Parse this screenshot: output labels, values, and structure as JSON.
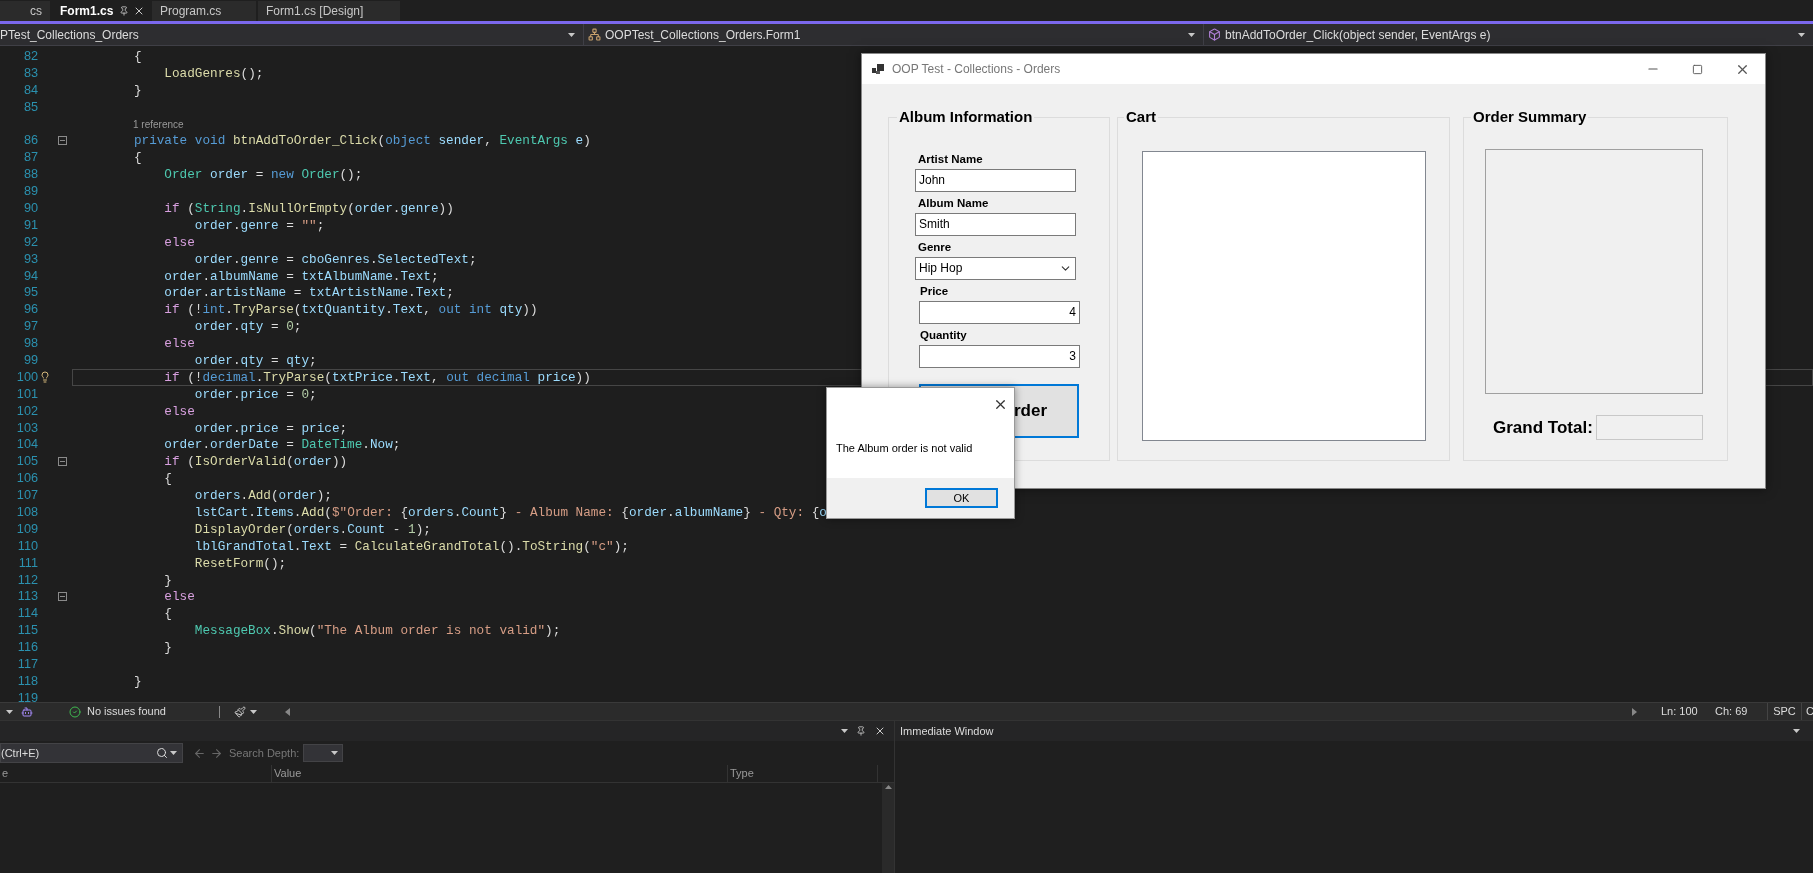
{
  "tabs": [
    {
      "label": "cs",
      "selected": false
    },
    {
      "label": "Form1.cs",
      "selected": true
    },
    {
      "label": "Program.cs",
      "selected": false
    },
    {
      "label": "Form1.cs [Design]",
      "selected": false
    }
  ],
  "nav_bar": {
    "project": "PTest_Collections_Orders",
    "type": "OOPTest_Collections_Orders.Form1",
    "member": "btnAddToOrder_Click(object sender, EventArgs e)"
  },
  "editor": {
    "lines": [
      {
        "kind": "code",
        "number": "82",
        "current": false,
        "fold": false,
        "tokens": [
          {
            "kind": "p",
            "text": "        {"
          }
        ]
      },
      {
        "kind": "code",
        "number": "83",
        "current": false,
        "fold": false,
        "tokens": [
          {
            "kind": "fn",
            "text": "            LoadGenres"
          },
          {
            "kind": "p",
            "text": "();"
          }
        ]
      },
      {
        "kind": "code",
        "number": "84",
        "current": false,
        "fold": false,
        "tokens": [
          {
            "kind": "p",
            "text": "        }"
          }
        ]
      },
      {
        "kind": "code",
        "number": "85",
        "current": false,
        "fold": false
      },
      {
        "kind": "codelens",
        "text": "1 reference",
        "current": false,
        "fold": false
      },
      {
        "kind": "code",
        "number": "86",
        "current": false,
        "fold": true,
        "tokens": [
          {
            "kind": "kw",
            "text": "        private"
          },
          {
            "kind": "kw",
            "text": " void"
          },
          {
            "kind": "fn",
            "text": " btnAddToOrder_Click"
          },
          {
            "kind": "p",
            "text": "("
          },
          {
            "kind": "kw",
            "text": "object"
          },
          {
            "kind": "var",
            "text": " sender"
          },
          {
            "kind": "p",
            "text": ", "
          },
          {
            "kind": "type",
            "text": "EventArgs"
          },
          {
            "kind": "var",
            "text": " e"
          },
          {
            "kind": "p",
            "text": ")"
          }
        ]
      },
      {
        "kind": "code",
        "number": "87",
        "current": false,
        "fold": false,
        "tokens": [
          {
            "kind": "p",
            "text": "        {"
          }
        ]
      },
      {
        "kind": "code",
        "number": "88",
        "current": false,
        "fold": false,
        "tokens": [
          {
            "kind": "type",
            "text": "            Order"
          },
          {
            "kind": "var",
            "text": " order"
          },
          {
            "kind": "p",
            "text": " = "
          },
          {
            "kind": "kw",
            "text": "new"
          },
          {
            "kind": "type",
            "text": " Order"
          },
          {
            "kind": "p",
            "text": "();"
          }
        ]
      },
      {
        "kind": "code",
        "number": "89",
        "current": false,
        "fold": false
      },
      {
        "kind": "code",
        "number": "90",
        "current": false,
        "fold": false,
        "tokens": [
          {
            "kind": "ctl",
            "text": "            if"
          },
          {
            "kind": "p",
            "text": " ("
          },
          {
            "kind": "type",
            "text": "String"
          },
          {
            "kind": "p",
            "text": "."
          },
          {
            "kind": "fn",
            "text": "IsNullOrEmpty"
          },
          {
            "kind": "p",
            "text": "("
          },
          {
            "kind": "var",
            "text": "order"
          },
          {
            "kind": "p",
            "text": "."
          },
          {
            "kind": "var",
            "text": "genre"
          },
          {
            "kind": "p",
            "text": "))"
          }
        ]
      },
      {
        "kind": "code",
        "number": "91",
        "current": false,
        "fold": false,
        "tokens": [
          {
            "kind": "var",
            "text": "                order"
          },
          {
            "kind": "p",
            "text": "."
          },
          {
            "kind": "var",
            "text": "genre"
          },
          {
            "kind": "p",
            "text": " = "
          },
          {
            "kind": "str",
            "text": "\"\""
          },
          {
            "kind": "p",
            "text": ";"
          }
        ]
      },
      {
        "kind": "code",
        "number": "92",
        "current": false,
        "fold": false,
        "tokens": [
          {
            "kind": "ctl",
            "text": "            else"
          }
        ]
      },
      {
        "kind": "code",
        "number": "93",
        "current": false,
        "fold": false,
        "tokens": [
          {
            "kind": "var",
            "text": "                order"
          },
          {
            "kind": "p",
            "text": "."
          },
          {
            "kind": "var",
            "text": "genre"
          },
          {
            "kind": "p",
            "text": " = "
          },
          {
            "kind": "var",
            "text": "cboGenres"
          },
          {
            "kind": "p",
            "text": "."
          },
          {
            "kind": "var",
            "text": "SelectedText"
          },
          {
            "kind": "p",
            "text": ";"
          }
        ]
      },
      {
        "kind": "code",
        "number": "94",
        "current": false,
        "fold": false,
        "tokens": [
          {
            "kind": "var",
            "text": "            order"
          },
          {
            "kind": "p",
            "text": "."
          },
          {
            "kind": "var",
            "text": "albumName"
          },
          {
            "kind": "p",
            "text": " = "
          },
          {
            "kind": "var",
            "text": "txtAlbumName"
          },
          {
            "kind": "p",
            "text": "."
          },
          {
            "kind": "var",
            "text": "Text"
          },
          {
            "kind": "p",
            "text": ";"
          }
        ]
      },
      {
        "kind": "code",
        "number": "95",
        "current": false,
        "fold": false,
        "tokens": [
          {
            "kind": "var",
            "text": "            order"
          },
          {
            "kind": "p",
            "text": "."
          },
          {
            "kind": "var",
            "text": "artistName"
          },
          {
            "kind": "p",
            "text": " = "
          },
          {
            "kind": "var",
            "text": "txtArtistName"
          },
          {
            "kind": "p",
            "text": "."
          },
          {
            "kind": "var",
            "text": "Text"
          },
          {
            "kind": "p",
            "text": ";"
          }
        ]
      },
      {
        "kind": "code",
        "number": "96",
        "current": false,
        "fold": false,
        "tokens": [
          {
            "kind": "ctl",
            "text": "            if"
          },
          {
            "kind": "p",
            "text": " (!"
          },
          {
            "kind": "kw",
            "text": "int"
          },
          {
            "kind": "p",
            "text": "."
          },
          {
            "kind": "fn",
            "text": "TryParse"
          },
          {
            "kind": "p",
            "text": "("
          },
          {
            "kind": "var",
            "text": "txtQuantity"
          },
          {
            "kind": "p",
            "text": "."
          },
          {
            "kind": "var",
            "text": "Text"
          },
          {
            "kind": "p",
            "text": ", "
          },
          {
            "kind": "kw",
            "text": "out"
          },
          {
            "kind": "kw",
            "text": " int"
          },
          {
            "kind": "var",
            "text": " qty"
          },
          {
            "kind": "p",
            "text": "))"
          }
        ]
      },
      {
        "kind": "code",
        "number": "97",
        "current": false,
        "fold": false,
        "tokens": [
          {
            "kind": "var",
            "text": "                order"
          },
          {
            "kind": "p",
            "text": "."
          },
          {
            "kind": "var",
            "text": "qty"
          },
          {
            "kind": "p",
            "text": " = "
          },
          {
            "kind": "num",
            "text": "0"
          },
          {
            "kind": "p",
            "text": ";"
          }
        ]
      },
      {
        "kind": "code",
        "number": "98",
        "current": false,
        "fold": false,
        "tokens": [
          {
            "kind": "ctl",
            "text": "            else"
          }
        ]
      },
      {
        "kind": "code",
        "number": "99",
        "current": false,
        "fold": false,
        "tokens": [
          {
            "kind": "var",
            "text": "                order"
          },
          {
            "kind": "p",
            "text": "."
          },
          {
            "kind": "var",
            "text": "qty"
          },
          {
            "kind": "p",
            "text": " = "
          },
          {
            "kind": "var",
            "text": "qty"
          },
          {
            "kind": "p",
            "text": ";"
          }
        ]
      },
      {
        "kind": "code",
        "number": "100",
        "current": true,
        "fold": false,
        "tokens": [
          {
            "kind": "ctl",
            "text": "            if"
          },
          {
            "kind": "p",
            "text": " (!"
          },
          {
            "kind": "kw",
            "text": "decimal"
          },
          {
            "kind": "p",
            "text": "."
          },
          {
            "kind": "fn",
            "text": "TryParse"
          },
          {
            "kind": "p",
            "text": "("
          },
          {
            "kind": "var",
            "text": "txtPrice"
          },
          {
            "kind": "p",
            "text": "."
          },
          {
            "kind": "var",
            "text": "Text"
          },
          {
            "kind": "p",
            "text": ", "
          },
          {
            "kind": "kw",
            "text": "out"
          },
          {
            "kind": "kw",
            "text": " decimal"
          },
          {
            "kind": "var",
            "text": " price"
          },
          {
            "kind": "p",
            "text": "))"
          }
        ]
      },
      {
        "kind": "code",
        "number": "101",
        "current": false,
        "fold": false,
        "tokens": [
          {
            "kind": "var",
            "text": "                order"
          },
          {
            "kind": "p",
            "text": "."
          },
          {
            "kind": "var",
            "text": "price"
          },
          {
            "kind": "p",
            "text": " = "
          },
          {
            "kind": "num",
            "text": "0"
          },
          {
            "kind": "p",
            "text": ";"
          }
        ]
      },
      {
        "kind": "code",
        "number": "102",
        "current": false,
        "fold": false,
        "tokens": [
          {
            "kind": "ctl",
            "text": "            else"
          }
        ]
      },
      {
        "kind": "code",
        "number": "103",
        "current": false,
        "fold": false,
        "tokens": [
          {
            "kind": "var",
            "text": "                order"
          },
          {
            "kind": "p",
            "text": "."
          },
          {
            "kind": "var",
            "text": "price"
          },
          {
            "kind": "p",
            "text": " = "
          },
          {
            "kind": "var",
            "text": "price"
          },
          {
            "kind": "p",
            "text": ";"
          }
        ]
      },
      {
        "kind": "code",
        "number": "104",
        "current": false,
        "fold": false,
        "tokens": [
          {
            "kind": "var",
            "text": "            order"
          },
          {
            "kind": "p",
            "text": "."
          },
          {
            "kind": "var",
            "text": "orderDate"
          },
          {
            "kind": "p",
            "text": " = "
          },
          {
            "kind": "type",
            "text": "DateTime"
          },
          {
            "kind": "p",
            "text": "."
          },
          {
            "kind": "var",
            "text": "Now"
          },
          {
            "kind": "p",
            "text": ";"
          }
        ]
      },
      {
        "kind": "code",
        "number": "105",
        "current": false,
        "fold": true,
        "tokens": [
          {
            "kind": "ctl",
            "text": "            if"
          },
          {
            "kind": "p",
            "text": " ("
          },
          {
            "kind": "fn",
            "text": "IsOrderValid"
          },
          {
            "kind": "p",
            "text": "("
          },
          {
            "kind": "var",
            "text": "order"
          },
          {
            "kind": "p",
            "text": "))"
          }
        ]
      },
      {
        "kind": "code",
        "number": "106",
        "current": false,
        "fold": false,
        "tokens": [
          {
            "kind": "p",
            "text": "            {"
          }
        ]
      },
      {
        "kind": "code",
        "number": "107",
        "current": false,
        "fold": false,
        "tokens": [
          {
            "kind": "var",
            "text": "                orders"
          },
          {
            "kind": "p",
            "text": "."
          },
          {
            "kind": "fn",
            "text": "Add"
          },
          {
            "kind": "p",
            "text": "("
          },
          {
            "kind": "var",
            "text": "order"
          },
          {
            "kind": "p",
            "text": ");"
          }
        ]
      },
      {
        "kind": "code",
        "number": "108",
        "current": false,
        "fold": false,
        "tokens": [
          {
            "kind": "var",
            "text": "                lstCart"
          },
          {
            "kind": "p",
            "text": "."
          },
          {
            "kind": "var",
            "text": "Items"
          },
          {
            "kind": "p",
            "text": "."
          },
          {
            "kind": "fn",
            "text": "Add"
          },
          {
            "kind": "p",
            "text": "("
          },
          {
            "kind": "str",
            "text": "$\"Order: "
          },
          {
            "kind": "p",
            "text": "{"
          },
          {
            "kind": "var",
            "text": "orders"
          },
          {
            "kind": "p",
            "text": "."
          },
          {
            "kind": "var",
            "text": "Count"
          },
          {
            "kind": "p",
            "text": "}"
          },
          {
            "kind": "str",
            "text": " - Album Name: "
          },
          {
            "kind": "p",
            "text": "{"
          },
          {
            "kind": "var",
            "text": "order"
          },
          {
            "kind": "p",
            "text": "."
          },
          {
            "kind": "var",
            "text": "albumName"
          },
          {
            "kind": "p",
            "text": "}"
          },
          {
            "kind": "str",
            "text": " - Qty: "
          },
          {
            "kind": "p",
            "text": "{"
          },
          {
            "kind": "var",
            "text": "o"
          }
        ]
      },
      {
        "kind": "code",
        "number": "109",
        "current": false,
        "fold": false,
        "tokens": [
          {
            "kind": "fn",
            "text": "                DisplayOrder"
          },
          {
            "kind": "p",
            "text": "("
          },
          {
            "kind": "var",
            "text": "orders"
          },
          {
            "kind": "p",
            "text": "."
          },
          {
            "kind": "var",
            "text": "Count"
          },
          {
            "kind": "p",
            "text": " - "
          },
          {
            "kind": "num",
            "text": "1"
          },
          {
            "kind": "p",
            "text": ");"
          }
        ]
      },
      {
        "kind": "code",
        "number": "110",
        "current": false,
        "fold": false,
        "tokens": [
          {
            "kind": "var",
            "text": "                lblGrandTotal"
          },
          {
            "kind": "p",
            "text": "."
          },
          {
            "kind": "var",
            "text": "Text"
          },
          {
            "kind": "p",
            "text": " = "
          },
          {
            "kind": "fn",
            "text": "CalculateGrandTotal"
          },
          {
            "kind": "p",
            "text": "()."
          },
          {
            "kind": "fn",
            "text": "ToString"
          },
          {
            "kind": "p",
            "text": "("
          },
          {
            "kind": "str",
            "text": "\"c\""
          },
          {
            "kind": "p",
            "text": ");"
          }
        ]
      },
      {
        "kind": "code",
        "number": "111",
        "current": false,
        "fold": false,
        "tokens": [
          {
            "kind": "fn",
            "text": "                ResetForm"
          },
          {
            "kind": "p",
            "text": "();"
          }
        ]
      },
      {
        "kind": "code",
        "number": "112",
        "current": false,
        "fold": false,
        "tokens": [
          {
            "kind": "p",
            "text": "            }"
          }
        ]
      },
      {
        "kind": "code",
        "number": "113",
        "current": false,
        "fold": true,
        "tokens": [
          {
            "kind": "ctl",
            "text": "            else"
          }
        ]
      },
      {
        "kind": "code",
        "number": "114",
        "current": false,
        "fold": false,
        "tokens": [
          {
            "kind": "p",
            "text": "            {"
          }
        ]
      },
      {
        "kind": "code",
        "number": "115",
        "current": false,
        "fold": false,
        "tokens": [
          {
            "kind": "type",
            "text": "                MessageBox"
          },
          {
            "kind": "p",
            "text": "."
          },
          {
            "kind": "fn",
            "text": "Show"
          },
          {
            "kind": "p",
            "text": "("
          },
          {
            "kind": "str",
            "text": "\"The Album order is not valid\""
          },
          {
            "kind": "p",
            "text": ");"
          }
        ]
      },
      {
        "kind": "code",
        "number": "116",
        "current": false,
        "fold": false,
        "tokens": [
          {
            "kind": "p",
            "text": "            }"
          }
        ]
      },
      {
        "kind": "code",
        "number": "117",
        "current": false,
        "fold": false
      },
      {
        "kind": "code",
        "number": "118",
        "current": false,
        "fold": false,
        "tokens": [
          {
            "kind": "p",
            "text": "        }"
          }
        ]
      },
      {
        "kind": "code",
        "number": "119",
        "current": false,
        "fold": false
      }
    ]
  },
  "status_bar": {
    "issues": "No issues found",
    "line": "Ln: 100",
    "column": "Ch: 69",
    "spacing": "SPC",
    "line_ending": "C"
  },
  "locals_panel": {
    "search": {
      "placeholder": "(Ctrl+E)"
    },
    "search_depth": "Search Depth:",
    "columns": [
      "e",
      "Value",
      "Type"
    ]
  },
  "immediate_panel": {
    "title": "Immediate Window"
  },
  "form_window": {
    "title": "OOP Test - Collections - Orders",
    "album_group": {
      "title": "Album Information",
      "fields": [
        {
          "kind": "text",
          "label": "Artist Name",
          "value": "John"
        },
        {
          "kind": "text",
          "label": "Album Name",
          "value": "Smith"
        },
        {
          "kind": "combo",
          "label": "Genre",
          "value": "Hip Hop"
        },
        {
          "kind": "number",
          "label": "Price",
          "value": "4"
        },
        {
          "kind": "number",
          "label": "Quantity",
          "value": "3"
        }
      ],
      "button": "rder"
    },
    "cart_group": {
      "title": "Cart"
    },
    "summary_group": {
      "title": "Order Summary",
      "total_label": "Grand Total:"
    }
  },
  "message_box": {
    "text": "The Album order is not valid",
    "button": "OK"
  }
}
